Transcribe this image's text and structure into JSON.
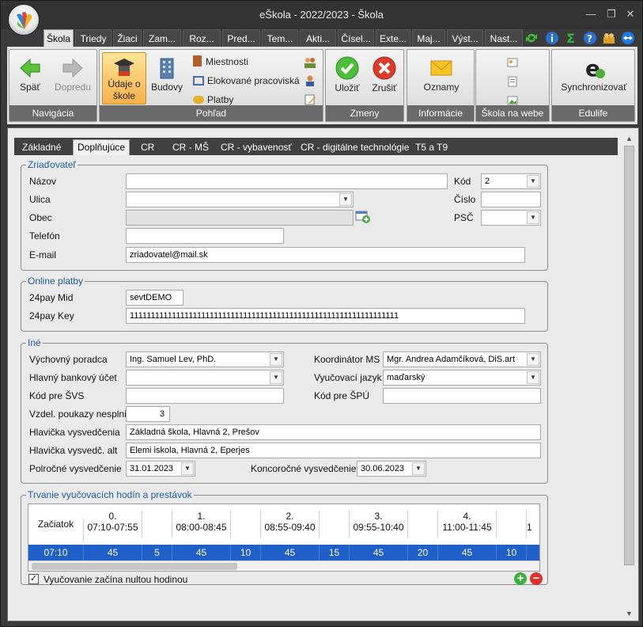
{
  "window": {
    "title": "eŠkola - 2022/2023 - Škola",
    "minimize": "—",
    "restore": "❐",
    "close": "✕"
  },
  "tabs": [
    "Škola",
    "Triedy",
    "Žiaci",
    "Zam...",
    "Roz...",
    "Pred...",
    "Tem...",
    "Akti...",
    "Čísel...",
    "Exte...",
    "Maj...",
    "Výst...",
    "Nast..."
  ],
  "ribbon": {
    "navigacia": {
      "label": "Navigácia",
      "back": "Späť",
      "forward": "Dopredu"
    },
    "pohlad": {
      "label": "Pohľad",
      "udaje1": "Údaje o",
      "udaje2": "škole",
      "budovy": "Budovy",
      "miestnosti": "Miestnosti",
      "elokovane": "Elokované pracoviská",
      "platby": "Platby"
    },
    "zmeny": {
      "label": "Zmeny",
      "ulozit": "Uložiť",
      "zrusit": "Zrušiť"
    },
    "informacie": {
      "label": "Informácie",
      "oznamy": "Oznamy"
    },
    "web": {
      "label": "Škola na webe"
    },
    "edulife": {
      "label": "Edulife",
      "sync": "Synchronizovať"
    }
  },
  "subtabs": [
    "Základné",
    "Doplňujúce",
    "CR",
    "CR - MŠ",
    "CR - vybavenosť",
    "CR - digitálne technológie",
    "T5 a T9"
  ],
  "zriadovatel": {
    "legend": "Zriaďovateľ",
    "nazov_label": "Názov",
    "nazov": "",
    "ulica_label": "Ulica",
    "ulica": "",
    "obec_label": "Obec",
    "obec": "",
    "telefon_label": "Telefón",
    "telefon": "",
    "email_label": "E-mail",
    "email": "zriadovatel@mail.sk",
    "kod_label": "Kód",
    "kod": "2",
    "cislo_label": "Číslo",
    "cislo": "",
    "psc_label": "PSČ",
    "psc": ""
  },
  "online": {
    "legend": "Online platby",
    "mid_label": "24pay Mid",
    "mid": "sevtDEMO",
    "key_label": "24pay Key",
    "key": "1111111111111111111111111111111111111111111111111111111111111111"
  },
  "ine": {
    "legend": "Iné",
    "poradca_label": "Výchovný poradca",
    "poradca": "Ing. Samuel Lev, PhD.",
    "koordinator_label": "Koordinátor MS",
    "koordinator": "Mgr. Andrea Adamčíková, DiS.art",
    "ucet_label": "Hlavný bankový účet",
    "ucet": "",
    "jazyk_label": "Vyučovací jazyk",
    "jazyk": "maďarský",
    "svs_label": "Kód pre ŠVS",
    "svs": "",
    "spu_label": "Kód pre ŠPÚ",
    "spu": "",
    "poukazy_label": "Vzdel. poukazy nesplnili",
    "poukazy": "3",
    "hlavicka_label": "Hlavička vysvedčenia",
    "hlavicka": "Základná škola, Hlavná 2, Prešov",
    "hlavicka_alt_label": "Hlavička vysvedč. alt",
    "hlavicka_alt": "Elemi iskola, Hlavná 2, Eperjes",
    "polrocne_label": "Polročné vysvedčenie",
    "polrocne": "31.01.2023",
    "koncorocne_label": "Koncoročné vysvedčenie",
    "koncorocne": "30.06.2023"
  },
  "trvanie": {
    "legend": "Trvanie vyučovacích hodín a prestávok",
    "headers": [
      "Začiatok",
      "0.\n07:10-07:55",
      "",
      "1.\n08:00-08:45",
      "",
      "2.\n08:55-09:40",
      "",
      "3.\n09:55-10:40",
      "",
      "4.\n11:00-11:45",
      "",
      "1"
    ],
    "values": [
      "07:10",
      "45",
      "5",
      "45",
      "10",
      "45",
      "15",
      "45",
      "20",
      "45",
      "10",
      ""
    ],
    "checkbox_label": "Vyučovanie začína nultou hodinou",
    "checkbox_checked": "✓",
    "add": "+",
    "remove": "−"
  }
}
